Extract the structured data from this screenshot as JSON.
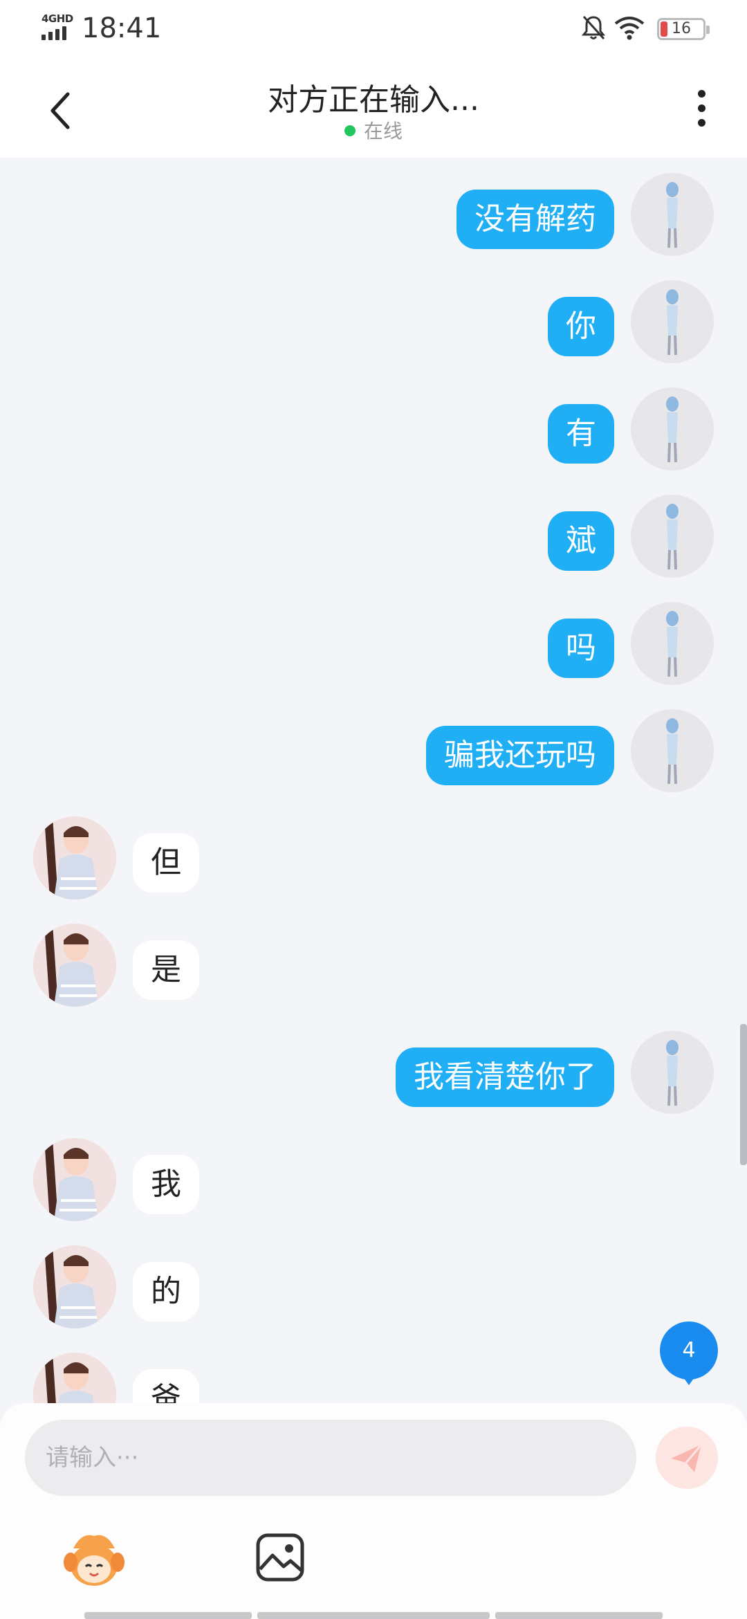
{
  "status_bar": {
    "network": "4GHD",
    "time": "18:41",
    "battery": "16",
    "icons": [
      "signal-icon",
      "mute-bell-icon",
      "wifi-icon",
      "battery-icon"
    ]
  },
  "header": {
    "title": "对方正在输入...",
    "status": "在线",
    "status_color": "#22c55e",
    "back_icon": "chevron-left-icon",
    "menu_icon": "more-vertical-icon"
  },
  "messages": [
    {
      "from": "me",
      "text": "没有解药"
    },
    {
      "from": "me",
      "text": "你"
    },
    {
      "from": "me",
      "text": "有"
    },
    {
      "from": "me",
      "text": "斌"
    },
    {
      "from": "me",
      "text": "吗"
    },
    {
      "from": "me",
      "text": "骗我还玩吗"
    },
    {
      "from": "them",
      "text": "但"
    },
    {
      "from": "them",
      "text": "是"
    },
    {
      "from": "me",
      "text": "我看清楚你了"
    },
    {
      "from": "them",
      "text": "我"
    },
    {
      "from": "them",
      "text": "的"
    },
    {
      "from": "them",
      "text": "爸"
    }
  ],
  "unread_count": "4",
  "input": {
    "placeholder": "请输入···",
    "send_icon": "send-icon"
  },
  "toolbar": {
    "emoji_icon": "mascot-emoji-icon",
    "image_icon": "image-icon"
  },
  "colors": {
    "accent": "#20aef5",
    "badge": "#1a8cf0",
    "chat_background": "#f3f5f8"
  }
}
